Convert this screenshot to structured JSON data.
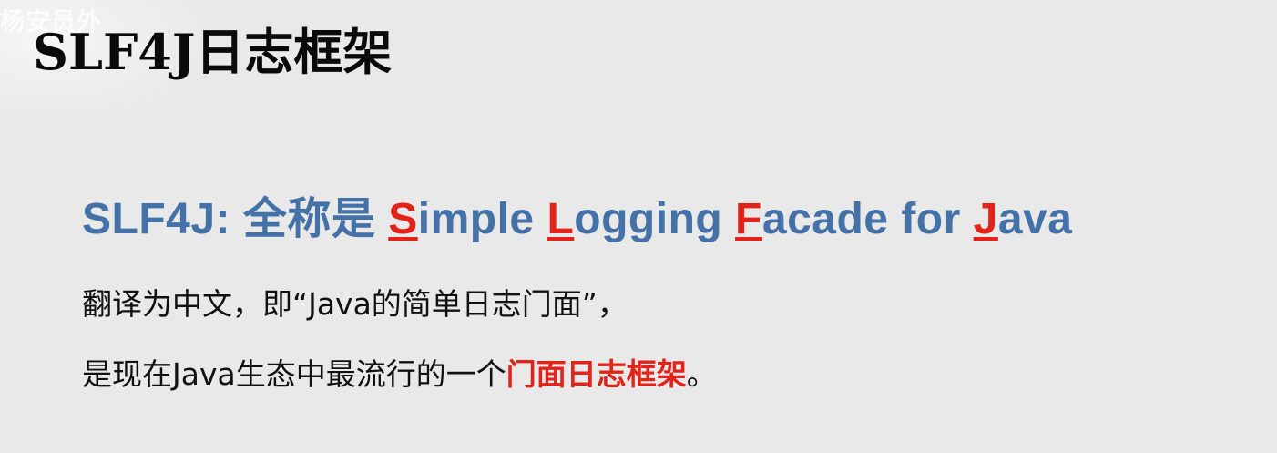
{
  "watermark": "杨安员外",
  "title": {
    "latin": "SLF4J",
    "cjk": "日志框架"
  },
  "headline": {
    "prefix": "SLF4J: 全称是 ",
    "word1_initial": "S",
    "word1_rest": "imple ",
    "word2_initial": "L",
    "word2_rest": "ogging ",
    "word3_initial": "F",
    "word3_rest": "acade for ",
    "word4_initial": "J",
    "word4_rest": "ava"
  },
  "paragraph": {
    "line1": "翻译为中文，即“Java的简单日志门面”，",
    "line2_before": "是现在Java生态中最流行的一个",
    "line2_highlight": "门面日志框架",
    "line2_after": "。"
  },
  "colors": {
    "background": "#e8e9e8",
    "headline": "#4472a8",
    "accent": "#e2231a",
    "title": "#0a0a0a"
  }
}
